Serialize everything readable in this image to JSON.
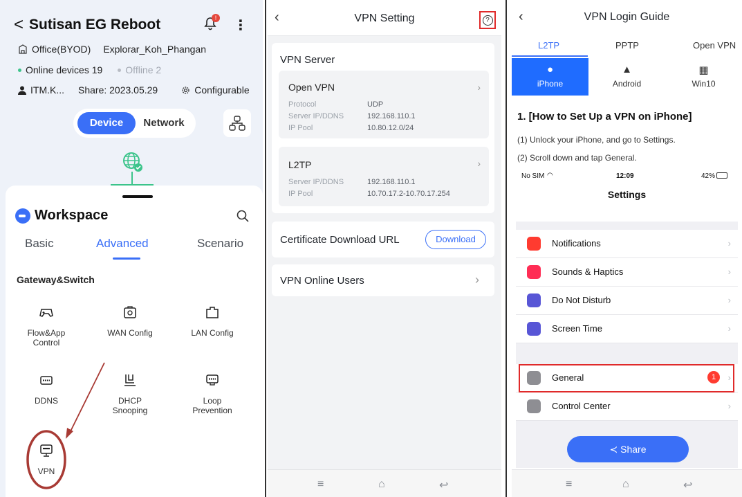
{
  "panel1": {
    "title": "Sutisan EG Reboot",
    "back_glyph": "<",
    "bell_badge": "!",
    "more_glyph": "⋮",
    "office": "Office(BYOD)",
    "site_name": "Explorar_Koh_Phangan",
    "online": "Online devices 19",
    "offline": "Offline 2",
    "owner": "ITM.K...",
    "share": "Share: 2023.05.29",
    "configurable": "Configurable",
    "toggle_device": "Device",
    "toggle_network": "Network",
    "workspace_title": "Workspace",
    "tabs": [
      "Basic",
      "Advanced",
      "Scenario"
    ],
    "section_title": "Gateway&Switch",
    "tools": [
      {
        "label": "Flow&App\nControl",
        "icon": "gamepad-icon"
      },
      {
        "label": "WAN Config",
        "icon": "wan-port-icon"
      },
      {
        "label": "LAN Config",
        "icon": "lan-port-icon"
      },
      {
        "label": "DDNS",
        "icon": "ddns-icon"
      },
      {
        "label": "DHCP\nSnooping",
        "icon": "dhcp-snooping-icon"
      },
      {
        "label": "Loop\nPrevention",
        "icon": "loop-prevention-icon"
      },
      {
        "label": "VPN",
        "icon": "vpn-icon"
      }
    ],
    "annotation_color": "#a83a34"
  },
  "panel2": {
    "title": "VPN Setting",
    "help_glyph": "?",
    "server_header": "VPN Server",
    "openvpn": {
      "name": "Open VPN",
      "protocol_label": "Protocol",
      "protocol_value": "UDP",
      "server_label": "Server IP/DDNS",
      "server_value": "192.168.110.1",
      "pool_label": "IP Pool",
      "pool_value": "10.80.12.0/24"
    },
    "l2tp": {
      "name": "L2TP",
      "server_label": "Server IP/DDNS",
      "server_value": "192.168.110.1",
      "pool_label": "IP Pool",
      "pool_value": "10.70.17.2-10.70.17.254"
    },
    "cert_label": "Certificate Download URL",
    "download_label": "Download",
    "online_users_label": "VPN Online Users",
    "chevron": "›"
  },
  "panel3": {
    "title": "VPN Login Guide",
    "protocol_tabs": [
      "L2TP",
      "PPTP",
      "Open VPN"
    ],
    "platform_tabs": [
      "iPhone",
      "Android",
      "Win10"
    ],
    "guide_title": "1. [How to Set Up a VPN on iPhone]",
    "step1": "(1) Unlock your iPhone, and go to Settings.",
    "step2": "(2) Scroll down and tap General.",
    "status_left": "No SIM",
    "status_time": "12:09",
    "status_battery": "42%",
    "settings_title": "Settings",
    "rows": [
      {
        "label": "Notifications",
        "color": "#ff3b30"
      },
      {
        "label": "Sounds & Haptics",
        "color": "#ff2d55"
      },
      {
        "label": "Do Not Disturb",
        "color": "#5856d6"
      },
      {
        "label": "Screen Time",
        "color": "#5856d6"
      },
      {
        "label": "General",
        "color": "#8e8e93"
      },
      {
        "label": "Control Center",
        "color": "#8e8e93"
      }
    ],
    "general_badge": "1",
    "share_label": "Share",
    "accent": "#3a6ff7",
    "highlight": "#e02a2a"
  }
}
